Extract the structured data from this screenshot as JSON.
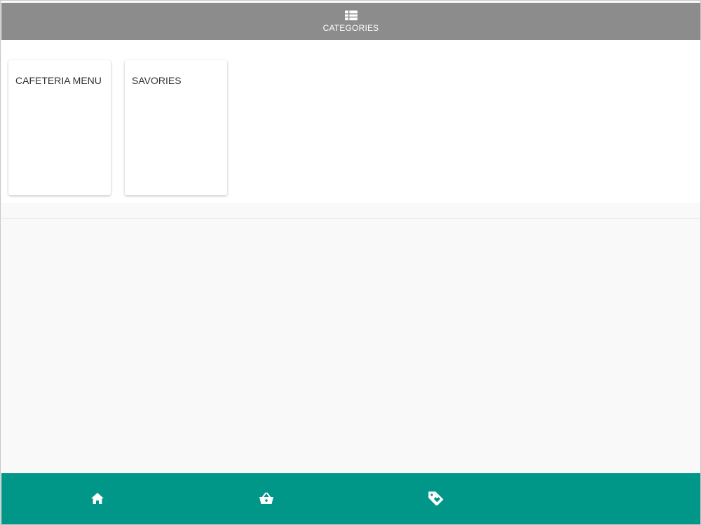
{
  "header": {
    "title": "CATEGORIES",
    "icon": "table-list-icon",
    "background": "#8c8c8c"
  },
  "categories": [
    {
      "label": "CAFETERIA MENU"
    },
    {
      "label": "SAVORIES"
    }
  ],
  "bottom_nav": {
    "background": "#009688",
    "items": [
      {
        "icon": "home-icon"
      },
      {
        "icon": "basket-icon"
      },
      {
        "icon": "tag-heart-icon"
      }
    ]
  }
}
